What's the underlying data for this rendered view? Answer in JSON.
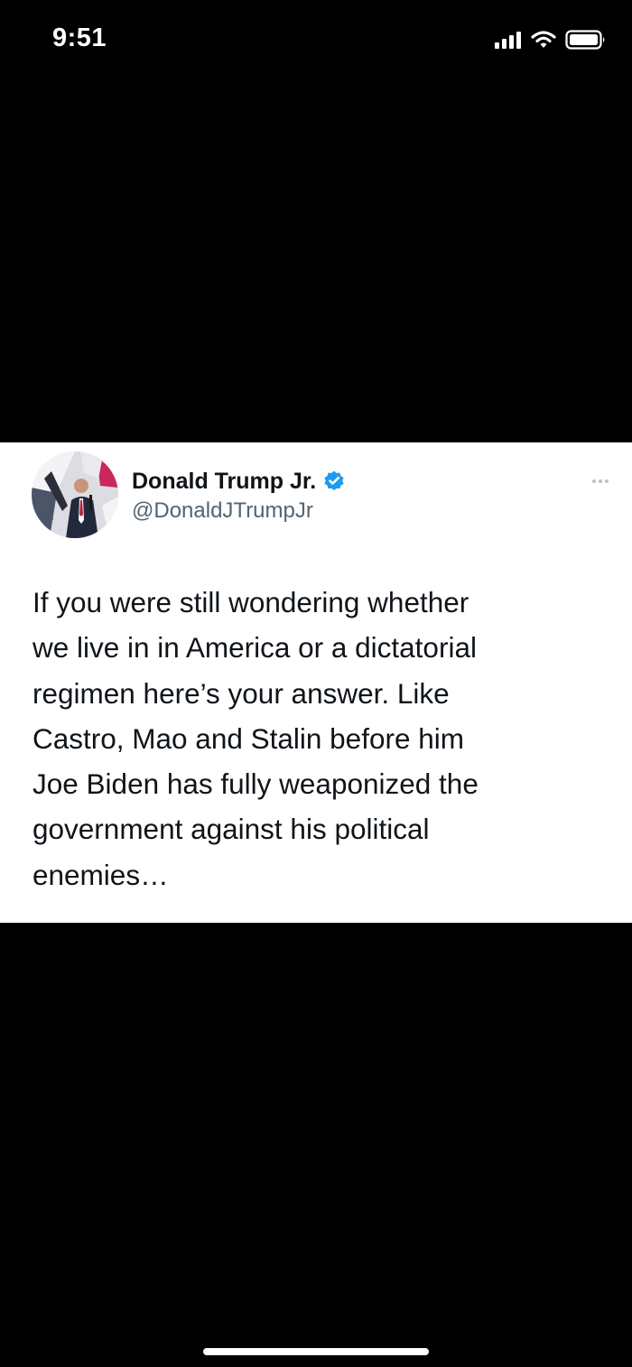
{
  "status_bar": {
    "time": "9:51",
    "icons": [
      "cellular-signal-icon",
      "wifi-icon",
      "battery-icon"
    ]
  },
  "tweet": {
    "author_name": "Donald Trump Jr.",
    "author_handle": "@DonaldJTrumpJr",
    "verified": true,
    "verified_color": "#1d9bf0",
    "avatar_icon": "profile-photo",
    "more_icon": "more-options-icon",
    "text_lines": [
      "If you were still wondering whether",
      "we live in in America or a dictatorial",
      "regimen here’s your answer. Like",
      "Castro, Mao and Stalin before him",
      "Joe Biden has fully weaponized the",
      "government against his political",
      "enemies…"
    ]
  },
  "colors": {
    "background": "#000000",
    "card_background": "#ffffff",
    "text_primary": "#0f1419",
    "text_secondary": "#536471"
  }
}
